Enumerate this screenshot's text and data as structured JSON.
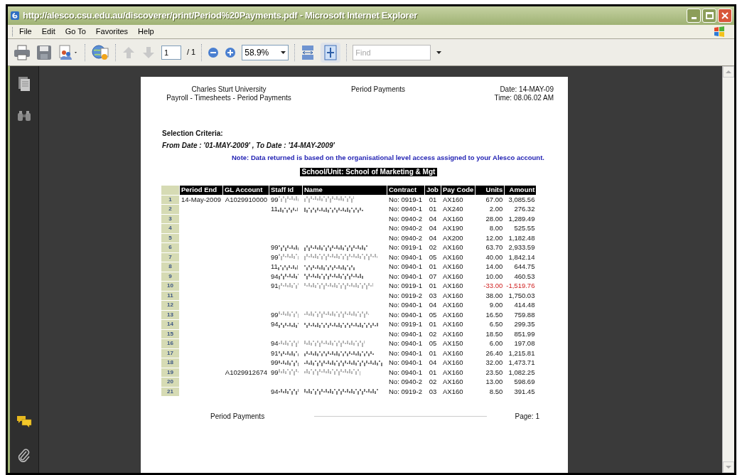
{
  "window": {
    "title": "http://alesco.csu.edu.au/discoverer/print/Period%20Payments.pdf - Microsoft Internet Explorer"
  },
  "menu": [
    "File",
    "Edit",
    "Go To",
    "Favorites",
    "Help"
  ],
  "toolbar": {
    "page": "1",
    "page_count": "/ 1",
    "zoom": "58.9%",
    "find_placeholder": "Find"
  },
  "report": {
    "org": "Charles Sturt University",
    "subtitle": "Payroll - Timesheets - Period Payments",
    "title": "Period Payments",
    "date": "Date: 14-MAY-09",
    "time": "Time: 08.06.02 AM",
    "criteria_label": "Selection Criteria:",
    "criteria": "From Date : '01-MAY-2009' , To Date : '14-MAY-2009'",
    "note": "Note: Data returned is based on the organisational level access assigned to your Alesco account.",
    "unit": "School/Unit: School of Marketing & Mgt",
    "columns": [
      "Period End",
      "GL Account",
      "Staff Id",
      "Name",
      "Contract",
      "Job",
      "Pay Code",
      "Units",
      "Amount"
    ],
    "rows": [
      {
        "n": "1",
        "period_end": "14-May-2009",
        "gl": "A1029910000",
        "staff_id": "99",
        "redacted": true,
        "contract": "No: 0919-1",
        "job": "01",
        "pay_code": "AX160",
        "units": "67.00",
        "amount": "3,085.56",
        "negative": false
      },
      {
        "n": "2",
        "staff_id": "11",
        "redacted": true,
        "contract": "No: 0940-1",
        "job": "01",
        "pay_code": "AX240",
        "units": "2.00",
        "amount": "276.32",
        "negative": false
      },
      {
        "n": "3",
        "redacted": false,
        "contract": "No: 0940-2",
        "job": "04",
        "pay_code": "AX160",
        "units": "28.00",
        "amount": "1,289.49",
        "negative": false
      },
      {
        "n": "4",
        "redacted": false,
        "contract": "No: 0940-2",
        "job": "04",
        "pay_code": "AX190",
        "units": "8.00",
        "amount": "525.55",
        "negative": false
      },
      {
        "n": "5",
        "redacted": false,
        "contract": "No: 0940-2",
        "job": "04",
        "pay_code": "AX200",
        "units": "12.00",
        "amount": "1,182.48",
        "negative": false
      },
      {
        "n": "6",
        "staff_id": "99",
        "redacted": true,
        "contract": "No: 0919-1",
        "job": "02",
        "pay_code": "AX160",
        "units": "63.70",
        "amount": "2,933.59",
        "negative": false
      },
      {
        "n": "7",
        "staff_id": "99",
        "redacted": true,
        "contract": "No: 0940-1",
        "job": "05",
        "pay_code": "AX160",
        "units": "40.00",
        "amount": "1,842.14",
        "negative": false
      },
      {
        "n": "8",
        "staff_id": "11",
        "redacted": true,
        "contract": "No: 0940-1",
        "job": "01",
        "pay_code": "AX160",
        "units": "14.00",
        "amount": "644.75",
        "negative": false
      },
      {
        "n": "9",
        "staff_id": "94",
        "redacted": true,
        "contract": "No: 0940-1",
        "job": "07",
        "pay_code": "AX160",
        "units": "10.00",
        "amount": "460.53",
        "negative": false
      },
      {
        "n": "10",
        "staff_id": "91",
        "redacted": true,
        "contract": "No: 0919-1",
        "job": "01",
        "pay_code": "AX160",
        "units": "-33.00",
        "amount": "-1,519.76",
        "negative": true
      },
      {
        "n": "11",
        "redacted": false,
        "contract": "No: 0919-2",
        "job": "03",
        "pay_code": "AX160",
        "units": "38.00",
        "amount": "1,750.03",
        "negative": false
      },
      {
        "n": "12",
        "redacted": false,
        "contract": "No: 0940-1",
        "job": "04",
        "pay_code": "AX160",
        "units": "9.00",
        "amount": "414.48",
        "negative": false
      },
      {
        "n": "13",
        "staff_id": "99",
        "redacted": true,
        "contract": "No: 0940-1",
        "job": "05",
        "pay_code": "AX160",
        "units": "16.50",
        "amount": "759.88",
        "negative": false
      },
      {
        "n": "14",
        "staff_id": "94",
        "redacted": true,
        "contract": "No: 0919-1",
        "job": "01",
        "pay_code": "AX160",
        "units": "6.50",
        "amount": "299.35",
        "negative": false
      },
      {
        "n": "15",
        "redacted": false,
        "contract": "No: 0940-1",
        "job": "02",
        "pay_code": "AX160",
        "units": "18.50",
        "amount": "851.99",
        "negative": false
      },
      {
        "n": "16",
        "staff_id": "94",
        "redacted": true,
        "contract": "No: 0940-1",
        "job": "05",
        "pay_code": "AX150",
        "units": "6.00",
        "amount": "197.08",
        "negative": false
      },
      {
        "n": "17",
        "staff_id": "91",
        "redacted": true,
        "contract": "No: 0940-1",
        "job": "01",
        "pay_code": "AX160",
        "units": "26.40",
        "amount": "1,215.81",
        "negative": false
      },
      {
        "n": "18",
        "staff_id": "99",
        "redacted": true,
        "contract": "No: 0940-1",
        "job": "04",
        "pay_code": "AX160",
        "units": "32.00",
        "amount": "1,473.71",
        "negative": false
      },
      {
        "n": "19",
        "gl": "A1029912674",
        "staff_id": "99",
        "redacted": true,
        "contract": "No: 0940-1",
        "job": "01",
        "pay_code": "AX160",
        "units": "23.50",
        "amount": "1,082.25",
        "negative": false
      },
      {
        "n": "20",
        "redacted": false,
        "contract": "No: 0940-2",
        "job": "02",
        "pay_code": "AX160",
        "units": "13.00",
        "amount": "598.69",
        "negative": false
      },
      {
        "n": "21",
        "staff_id": "94",
        "redacted": true,
        "contract": "No: 0919-2",
        "job": "03",
        "pay_code": "AX160",
        "units": "8.50",
        "amount": "391.45",
        "negative": false
      }
    ],
    "footer": "Period Payments",
    "page_label": "Page: 1"
  }
}
